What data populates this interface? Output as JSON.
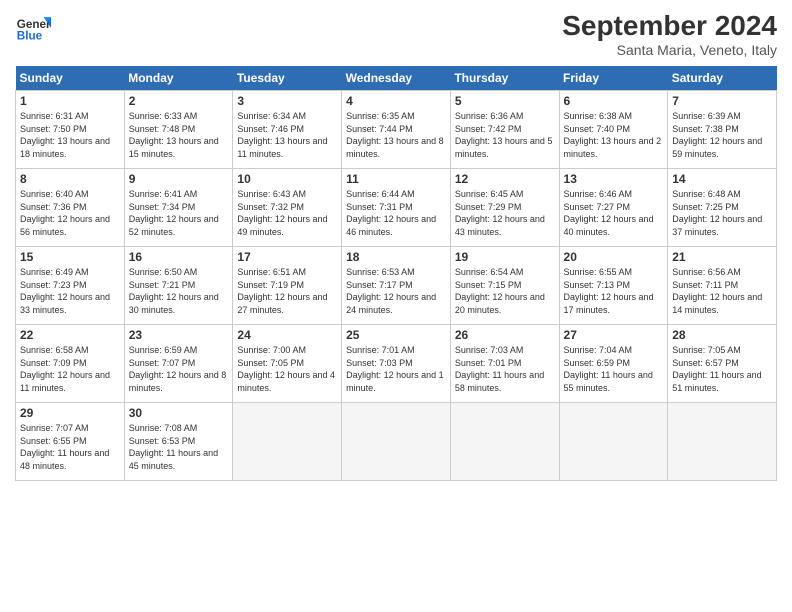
{
  "header": {
    "logo_general": "General",
    "logo_blue": "Blue",
    "month_title": "September 2024",
    "location": "Santa Maria, Veneto, Italy"
  },
  "days_of_week": [
    "Sunday",
    "Monday",
    "Tuesday",
    "Wednesday",
    "Thursday",
    "Friday",
    "Saturday"
  ],
  "weeks": [
    [
      {
        "num": "1",
        "rise": "6:31 AM",
        "set": "7:50 PM",
        "daylight": "13 hours and 18 minutes."
      },
      {
        "num": "2",
        "rise": "6:33 AM",
        "set": "7:48 PM",
        "daylight": "13 hours and 15 minutes."
      },
      {
        "num": "3",
        "rise": "6:34 AM",
        "set": "7:46 PM",
        "daylight": "13 hours and 11 minutes."
      },
      {
        "num": "4",
        "rise": "6:35 AM",
        "set": "7:44 PM",
        "daylight": "13 hours and 8 minutes."
      },
      {
        "num": "5",
        "rise": "6:36 AM",
        "set": "7:42 PM",
        "daylight": "13 hours and 5 minutes."
      },
      {
        "num": "6",
        "rise": "6:38 AM",
        "set": "7:40 PM",
        "daylight": "13 hours and 2 minutes."
      },
      {
        "num": "7",
        "rise": "6:39 AM",
        "set": "7:38 PM",
        "daylight": "12 hours and 59 minutes."
      }
    ],
    [
      {
        "num": "8",
        "rise": "6:40 AM",
        "set": "7:36 PM",
        "daylight": "12 hours and 56 minutes."
      },
      {
        "num": "9",
        "rise": "6:41 AM",
        "set": "7:34 PM",
        "daylight": "12 hours and 52 minutes."
      },
      {
        "num": "10",
        "rise": "6:43 AM",
        "set": "7:32 PM",
        "daylight": "12 hours and 49 minutes."
      },
      {
        "num": "11",
        "rise": "6:44 AM",
        "set": "7:31 PM",
        "daylight": "12 hours and 46 minutes."
      },
      {
        "num": "12",
        "rise": "6:45 AM",
        "set": "7:29 PM",
        "daylight": "12 hours and 43 minutes."
      },
      {
        "num": "13",
        "rise": "6:46 AM",
        "set": "7:27 PM",
        "daylight": "12 hours and 40 minutes."
      },
      {
        "num": "14",
        "rise": "6:48 AM",
        "set": "7:25 PM",
        "daylight": "12 hours and 37 minutes."
      }
    ],
    [
      {
        "num": "15",
        "rise": "6:49 AM",
        "set": "7:23 PM",
        "daylight": "12 hours and 33 minutes."
      },
      {
        "num": "16",
        "rise": "6:50 AM",
        "set": "7:21 PM",
        "daylight": "12 hours and 30 minutes."
      },
      {
        "num": "17",
        "rise": "6:51 AM",
        "set": "7:19 PM",
        "daylight": "12 hours and 27 minutes."
      },
      {
        "num": "18",
        "rise": "6:53 AM",
        "set": "7:17 PM",
        "daylight": "12 hours and 24 minutes."
      },
      {
        "num": "19",
        "rise": "6:54 AM",
        "set": "7:15 PM",
        "daylight": "12 hours and 20 minutes."
      },
      {
        "num": "20",
        "rise": "6:55 AM",
        "set": "7:13 PM",
        "daylight": "12 hours and 17 minutes."
      },
      {
        "num": "21",
        "rise": "6:56 AM",
        "set": "7:11 PM",
        "daylight": "12 hours and 14 minutes."
      }
    ],
    [
      {
        "num": "22",
        "rise": "6:58 AM",
        "set": "7:09 PM",
        "daylight": "12 hours and 11 minutes."
      },
      {
        "num": "23",
        "rise": "6:59 AM",
        "set": "7:07 PM",
        "daylight": "12 hours and 8 minutes."
      },
      {
        "num": "24",
        "rise": "7:00 AM",
        "set": "7:05 PM",
        "daylight": "12 hours and 4 minutes."
      },
      {
        "num": "25",
        "rise": "7:01 AM",
        "set": "7:03 PM",
        "daylight": "12 hours and 1 minute."
      },
      {
        "num": "26",
        "rise": "7:03 AM",
        "set": "7:01 PM",
        "daylight": "11 hours and 58 minutes."
      },
      {
        "num": "27",
        "rise": "7:04 AM",
        "set": "6:59 PM",
        "daylight": "11 hours and 55 minutes."
      },
      {
        "num": "28",
        "rise": "7:05 AM",
        "set": "6:57 PM",
        "daylight": "11 hours and 51 minutes."
      }
    ],
    [
      {
        "num": "29",
        "rise": "7:07 AM",
        "set": "6:55 PM",
        "daylight": "11 hours and 48 minutes."
      },
      {
        "num": "30",
        "rise": "7:08 AM",
        "set": "6:53 PM",
        "daylight": "11 hours and 45 minutes."
      },
      null,
      null,
      null,
      null,
      null
    ]
  ]
}
